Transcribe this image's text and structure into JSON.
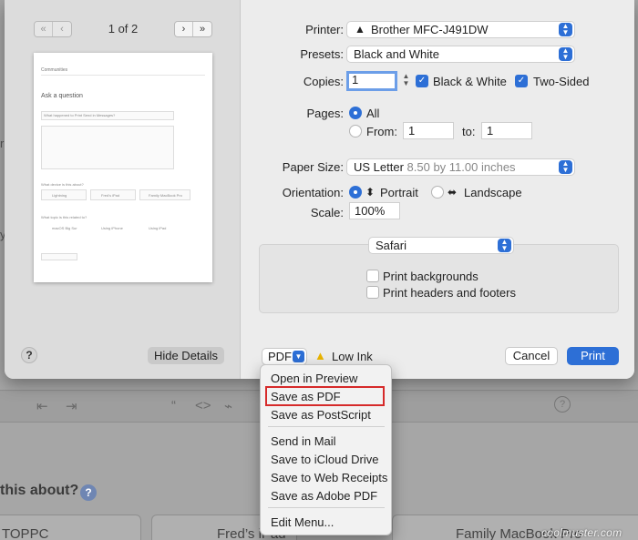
{
  "background": {
    "question_text": "this about?",
    "question_mark": "?",
    "help_mark": "?",
    "cards": [
      {
        "label": "TOPPC"
      },
      {
        "label": "Fred’s iPad"
      },
      {
        "label": "Family MacBook Pro"
      }
    ],
    "side_chars": [
      "r",
      "y"
    ],
    "toolbar_glyphs": [
      "⇤",
      "⇥",
      "“",
      "<>",
      "⌁"
    ]
  },
  "preview": {
    "page_indicator": "1 of 2",
    "nav": {
      "first": "«",
      "prev": "‹",
      "next": "›",
      "last": "»"
    },
    "thumbnail": {
      "site": "Communities",
      "heading": "Ask a question",
      "q1": "What happened to Print Send in Messages?",
      "q2": "What device is this about?",
      "q3": "What topic is this related to?",
      "devices": [
        "Lightning",
        "Fred's iPad",
        "Family MacBook Pro"
      ],
      "topics": [
        "macOS Big Sur",
        "Using iPhone",
        "Using iPad"
      ]
    },
    "help_label": "?",
    "hide_details_label": "Hide Details"
  },
  "settings": {
    "printer_label": "Printer:",
    "printer_value": "Brother MFC-J491DW",
    "presets_label": "Presets:",
    "presets_value": "Black and White",
    "copies_label": "Copies:",
    "copies_value": "1",
    "bw_label": "Black & White",
    "bw_checked": true,
    "two_sided_label": "Two-Sided",
    "two_sided_checked": true,
    "pages_label": "Pages:",
    "pages_all_label": "All",
    "pages_from_label": "From:",
    "pages_from_value": "1",
    "pages_to_label": "to:",
    "pages_to_value": "1",
    "paper_size_label": "Paper Size:",
    "paper_size_value": "US Letter",
    "paper_size_detail": "8.50 by 11.00 inches",
    "orientation_label": "Orientation:",
    "portrait_label": "Portrait",
    "landscape_label": "Landscape",
    "scale_label": "Scale:",
    "scale_value": "100%",
    "app_section": "Safari",
    "print_backgrounds_label": "Print backgrounds",
    "print_headers_label": "Print headers and footers"
  },
  "bottom_bar": {
    "pdf_label": "PDF",
    "low_ink_label": "Low Ink",
    "cancel_label": "Cancel",
    "print_label": "Print"
  },
  "pdf_menu": {
    "items": [
      {
        "label": "Open in Preview"
      },
      {
        "label": "Save as PDF",
        "highlighted": true
      },
      {
        "label": "Save as PostScript"
      },
      {
        "label": "Send in Mail"
      },
      {
        "label": "Save to iCloud Drive"
      },
      {
        "label": "Save to Web Receipts"
      },
      {
        "label": "Save as Adobe PDF"
      },
      {
        "label": "Edit Menu..."
      }
    ]
  },
  "watermark": "coolmuster.com",
  "colors": {
    "accent": "#2d6fd6",
    "highlight_border": "#d62a2a",
    "warning": "#e9b400"
  }
}
